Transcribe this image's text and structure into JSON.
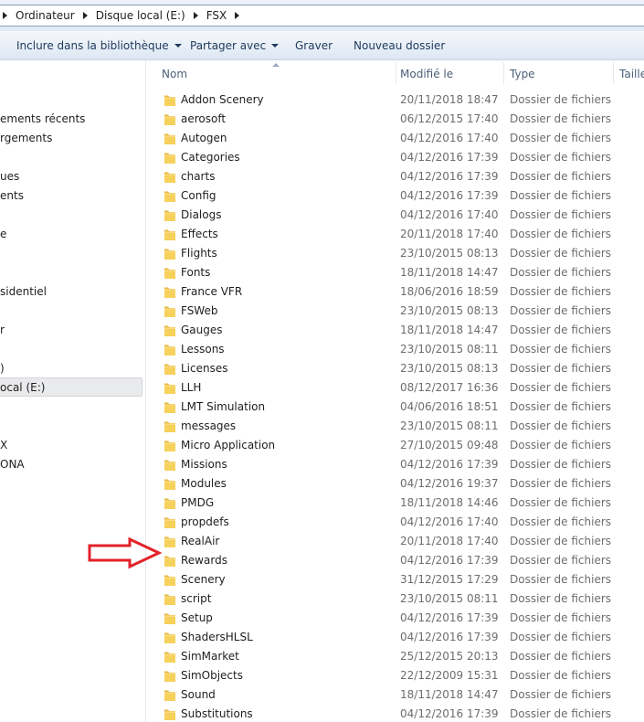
{
  "breadcrumb": {
    "items": [
      "Ordinateur",
      "Disque local (E:)",
      "FSX"
    ]
  },
  "toolbar": {
    "include_library": "Inclure dans la bibliothèque",
    "share_with": "Partager avec",
    "burn": "Graver",
    "new_folder": "Nouveau dossier"
  },
  "nav": {
    "items": [
      "ements récents",
      "rgements",
      "ues",
      "ents",
      "e",
      "sidentiel",
      "r",
      ")",
      "ocal (E:)",
      "X",
      "ONA"
    ],
    "selected_index": 8
  },
  "columns": {
    "name": "Nom",
    "modified": "Modifié le",
    "type": "Type",
    "size": "Taille"
  },
  "files": [
    {
      "name": "Addon Scenery",
      "date": "20/11/2018 18:47",
      "type": "Dossier de fichiers"
    },
    {
      "name": "aerosoft",
      "date": "06/12/2015 17:40",
      "type": "Dossier de fichiers"
    },
    {
      "name": "Autogen",
      "date": "04/12/2016 17:40",
      "type": "Dossier de fichiers"
    },
    {
      "name": "Categories",
      "date": "04/12/2016 17:39",
      "type": "Dossier de fichiers"
    },
    {
      "name": "charts",
      "date": "04/12/2016 17:39",
      "type": "Dossier de fichiers"
    },
    {
      "name": "Config",
      "date": "04/12/2016 17:39",
      "type": "Dossier de fichiers"
    },
    {
      "name": "Dialogs",
      "date": "04/12/2016 17:40",
      "type": "Dossier de fichiers"
    },
    {
      "name": "Effects",
      "date": "20/11/2018 17:40",
      "type": "Dossier de fichiers"
    },
    {
      "name": "Flights",
      "date": "23/10/2015 08:13",
      "type": "Dossier de fichiers"
    },
    {
      "name": "Fonts",
      "date": "18/11/2018 14:47",
      "type": "Dossier de fichiers"
    },
    {
      "name": "France VFR",
      "date": "18/06/2016 18:59",
      "type": "Dossier de fichiers"
    },
    {
      "name": "FSWeb",
      "date": "23/10/2015 08:13",
      "type": "Dossier de fichiers"
    },
    {
      "name": "Gauges",
      "date": "18/11/2018 14:47",
      "type": "Dossier de fichiers"
    },
    {
      "name": "Lessons",
      "date": "23/10/2015 08:11",
      "type": "Dossier de fichiers"
    },
    {
      "name": "Licenses",
      "date": "23/10/2015 08:13",
      "type": "Dossier de fichiers"
    },
    {
      "name": "LLH",
      "date": "08/12/2017 16:36",
      "type": "Dossier de fichiers"
    },
    {
      "name": "LMT Simulation",
      "date": "04/06/2016 18:51",
      "type": "Dossier de fichiers"
    },
    {
      "name": "messages",
      "date": "23/10/2015 08:11",
      "type": "Dossier de fichiers"
    },
    {
      "name": "Micro Application",
      "date": "27/10/2015 09:48",
      "type": "Dossier de fichiers"
    },
    {
      "name": "Missions",
      "date": "04/12/2016 17:39",
      "type": "Dossier de fichiers"
    },
    {
      "name": "Modules",
      "date": "04/12/2016 19:37",
      "type": "Dossier de fichiers"
    },
    {
      "name": "PMDG",
      "date": "18/11/2018 14:46",
      "type": "Dossier de fichiers"
    },
    {
      "name": "propdefs",
      "date": "04/12/2016 17:40",
      "type": "Dossier de fichiers"
    },
    {
      "name": "RealAir",
      "date": "20/11/2018 17:40",
      "type": "Dossier de fichiers"
    },
    {
      "name": "Rewards",
      "date": "04/12/2016 17:39",
      "type": "Dossier de fichiers"
    },
    {
      "name": "Scenery",
      "date": "31/12/2015 17:29",
      "type": "Dossier de fichiers"
    },
    {
      "name": "script",
      "date": "23/10/2015 08:11",
      "type": "Dossier de fichiers"
    },
    {
      "name": "Setup",
      "date": "04/12/2016 17:39",
      "type": "Dossier de fichiers"
    },
    {
      "name": "ShadersHLSL",
      "date": "04/12/2016 17:39",
      "type": "Dossier de fichiers"
    },
    {
      "name": "SimMarket",
      "date": "25/12/2015 20:13",
      "type": "Dossier de fichiers"
    },
    {
      "name": "SimObjects",
      "date": "22/12/2009 15:31",
      "type": "Dossier de fichiers"
    },
    {
      "name": "Sound",
      "date": "18/11/2018 14:47",
      "type": "Dossier de fichiers"
    },
    {
      "name": "Substitutions",
      "date": "04/12/2016 17:39",
      "type": "Dossier de fichiers"
    }
  ],
  "colors": {
    "folder": "#f3c84e",
    "annotation": "#e3222a"
  }
}
